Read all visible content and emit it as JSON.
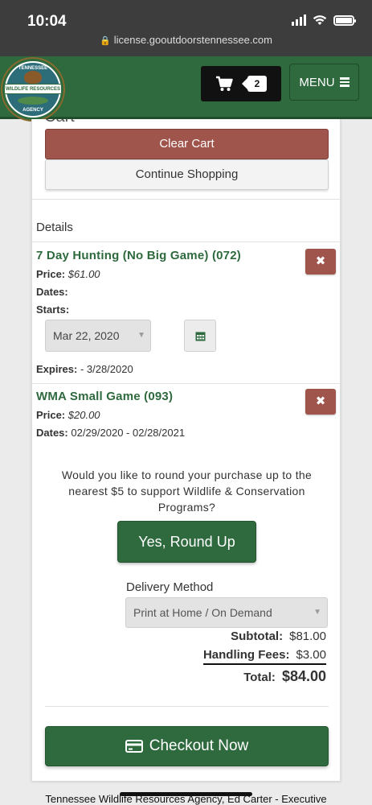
{
  "status_bar": {
    "time": "10:04",
    "url": "license.gooutdoorstennessee.com"
  },
  "header": {
    "logo_text": {
      "top": "TENNESSEE",
      "band": "WILDLIFE RESOURCES",
      "bottom": "AGENCY"
    },
    "cart_count": "2",
    "menu_label": "MENU",
    "color": "#2e6a3e"
  },
  "cart": {
    "heading": "Cart",
    "clear_label": "Clear Cart",
    "continue_label": "Continue Shopping",
    "details_title": "Details",
    "items": [
      {
        "name": "7 Day Hunting (No Big Game) (072)",
        "price_label": "Price:",
        "price": "$61.00",
        "dates_label": "Dates:",
        "dates": "",
        "starts_label": "Starts:",
        "start_date": "Mar 22, 2020",
        "expires_label": "Expires:",
        "expires": "- 3/28/2020",
        "remove_icon": "close-icon"
      },
      {
        "name": "WMA Small Game (093)",
        "price_label": "Price:",
        "price": "$20.00",
        "dates_label": "Dates:",
        "dates": "02/29/2020 - 02/28/2021",
        "remove_icon": "close-icon"
      }
    ],
    "round_up_prompt": "Would you like to round your purchase up to the nearest $5 to support Wildlife & Conservation Programs?",
    "round_up_button": "Yes, Round Up",
    "delivery_label": "Delivery Method",
    "delivery_value": "Print at Home / On Demand",
    "subtotal_label": "Subtotal:",
    "subtotal": "$81.00",
    "handling_label": "Handling Fees:",
    "handling": "$3.00",
    "total_label": "Total:",
    "total": "$84.00",
    "checkout_label": "Checkout Now",
    "danger_color": "#a0554c"
  },
  "footer": {
    "text": "Tennessee Wildlife Resources Agency, Ed Carter - Executive"
  }
}
